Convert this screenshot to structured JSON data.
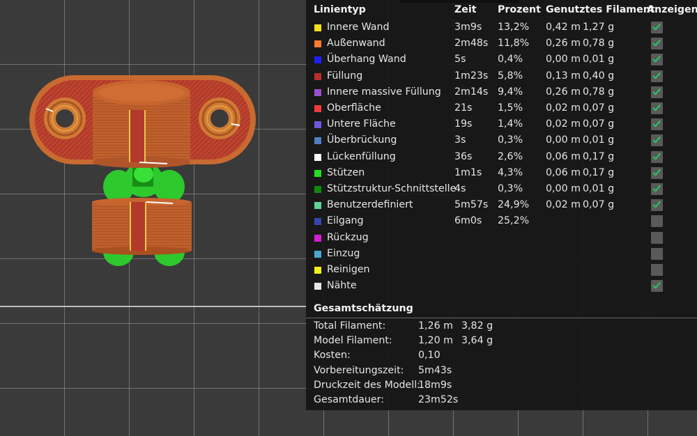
{
  "legend": {
    "headers": {
      "type": "Linientyp",
      "time": "Zeit",
      "percent": "Prozent",
      "filament": "Genutztes Filament",
      "show": "Anzeigen"
    },
    "rows": [
      {
        "label": "Innere Wand",
        "color": "#f5e11c",
        "time": "3m9s",
        "percent": "13,2%",
        "length": "0,42 m",
        "weight": "1,27 g",
        "shown": true
      },
      {
        "label": "Außenwand",
        "color": "#ff7a33",
        "time": "2m48s",
        "percent": "11,8%",
        "length": "0,26 m",
        "weight": "0,78 g",
        "shown": true
      },
      {
        "label": "Überhang Wand",
        "color": "#1f1fff",
        "time": "5s",
        "percent": "0,4%",
        "length": "0,00 m",
        "weight": "0,01 g",
        "shown": true
      },
      {
        "label": "Füllung",
        "color": "#b82e2e",
        "time": "1m23s",
        "percent": "5,8%",
        "length": "0,13 m",
        "weight": "0,40 g",
        "shown": true
      },
      {
        "label": "Innere massive Füllung",
        "color": "#9a4fd0",
        "time": "2m14s",
        "percent": "9,4%",
        "length": "0,26 m",
        "weight": "0,78 g",
        "shown": true
      },
      {
        "label": "Oberfläche",
        "color": "#f03a3a",
        "time": "21s",
        "percent": "1,5%",
        "length": "0,02 m",
        "weight": "0,07 g",
        "shown": true
      },
      {
        "label": "Untere Fläche",
        "color": "#6a5ad8",
        "time": "19s",
        "percent": "1,4%",
        "length": "0,02 m",
        "weight": "0,07 g",
        "shown": true
      },
      {
        "label": "Überbrückung",
        "color": "#4f7fc0",
        "time": "3s",
        "percent": "0,3%",
        "length": "0,00 m",
        "weight": "0,01 g",
        "shown": true
      },
      {
        "label": "Lückenfüllung",
        "color": "#ffffff",
        "time": "36s",
        "percent": "2,6%",
        "length": "0,06 m",
        "weight": "0,17 g",
        "shown": true
      },
      {
        "label": "Stützen",
        "color": "#21e021",
        "time": "1m1s",
        "percent": "4,3%",
        "length": "0,06 m",
        "weight": "0,17 g",
        "shown": true
      },
      {
        "label": "Stützstruktur-Schnittstelle",
        "color": "#0f8a0f",
        "time": "4s",
        "percent": "0,3%",
        "length": "0,00 m",
        "weight": "0,01 g",
        "shown": true
      },
      {
        "label": "Benutzerdefiniert",
        "color": "#5fd39a",
        "time": "5m57s",
        "percent": "24,9%",
        "length": "0,02 m",
        "weight": "0,07 g",
        "shown": true
      },
      {
        "label": "Eilgang",
        "color": "#3545b0",
        "time": "6m0s",
        "percent": "25,2%",
        "length": "",
        "weight": "",
        "shown": false
      },
      {
        "label": "Rückzug",
        "color": "#d41ed4",
        "time": "",
        "percent": "",
        "length": "",
        "weight": "",
        "shown": false
      },
      {
        "label": "Einzug",
        "color": "#4aa6d6",
        "time": "",
        "percent": "",
        "length": "",
        "weight": "",
        "shown": false
      },
      {
        "label": "Reinigen",
        "color": "#f0f01a",
        "time": "",
        "percent": "",
        "length": "",
        "weight": "",
        "shown": false
      },
      {
        "label": "Nähte",
        "color": "#e6e6e6",
        "time": "",
        "percent": "",
        "length": "",
        "weight": "",
        "shown": true
      }
    ]
  },
  "summary": {
    "title": "Gesamtschätzung",
    "rows": [
      {
        "label": "Total Filament:",
        "value": "1,26 m",
        "value2": "3,82 g"
      },
      {
        "label": "Model Filament:",
        "value": "1,20 m",
        "value2": "3,64 g"
      },
      {
        "label": "Kosten:",
        "value": "0,10",
        "value2": ""
      },
      {
        "label": "Vorbereitungszeit:",
        "value": "5m43s",
        "value2": ""
      },
      {
        "label": "Druckzeit des Modell:",
        "value": "18m9s",
        "value2": ""
      },
      {
        "label": "Gesamtdauer:",
        "value": "23m52s",
        "value2": ""
      }
    ]
  },
  "colors": {
    "panel_bg": "#161616",
    "checkbox_tick": "#29c76b",
    "model_infill": "#b83a2a",
    "model_wall": "#c8642e",
    "support": "#2dc92d"
  }
}
